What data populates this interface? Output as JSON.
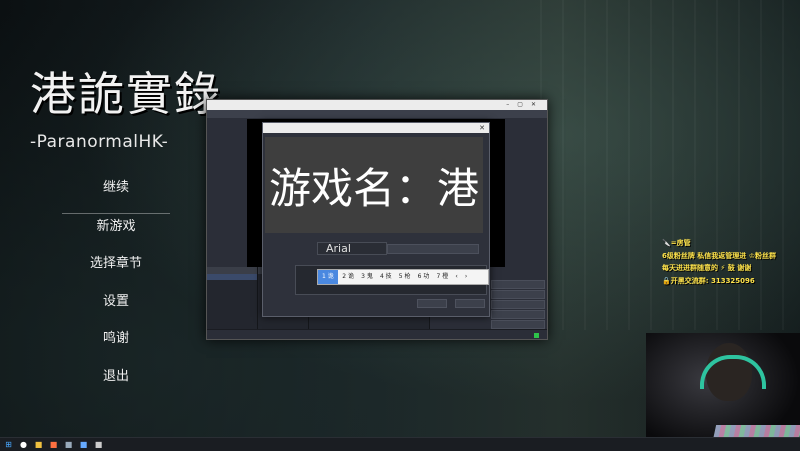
{
  "game": {
    "title_cjk": "港詭實錄",
    "title_en": "-ParanormalHK-",
    "menu": [
      {
        "label": "继续"
      },
      {
        "label": "新游戏"
      },
      {
        "label": "选择章节"
      },
      {
        "label": "设置"
      },
      {
        "label": "鸣谢"
      },
      {
        "label": "退出"
      }
    ]
  },
  "text_dialog": {
    "preview_text": "游戏名：港",
    "font_value": "Arial",
    "ime_candidates": [
      "1 诡",
      "2 诡",
      "3 鬼",
      "4 技",
      "5 枪",
      "6 功",
      "7 橙",
      "‹",
      "›"
    ]
  },
  "overlay": {
    "line1": "🔪=房管",
    "line2": "6级粉丝牌 私信我返管理进 ♔粉丝群",
    "line3": "每天进进群随意的 ⚡ 鼓 谢谢",
    "line4_prefix": "🔒开黑交流群:",
    "qq": "313325096"
  },
  "colors": {
    "overlay_text": "#ffe34a",
    "ime_highlight": "#4a88e0",
    "rec_indicator": "#2ec44a"
  }
}
